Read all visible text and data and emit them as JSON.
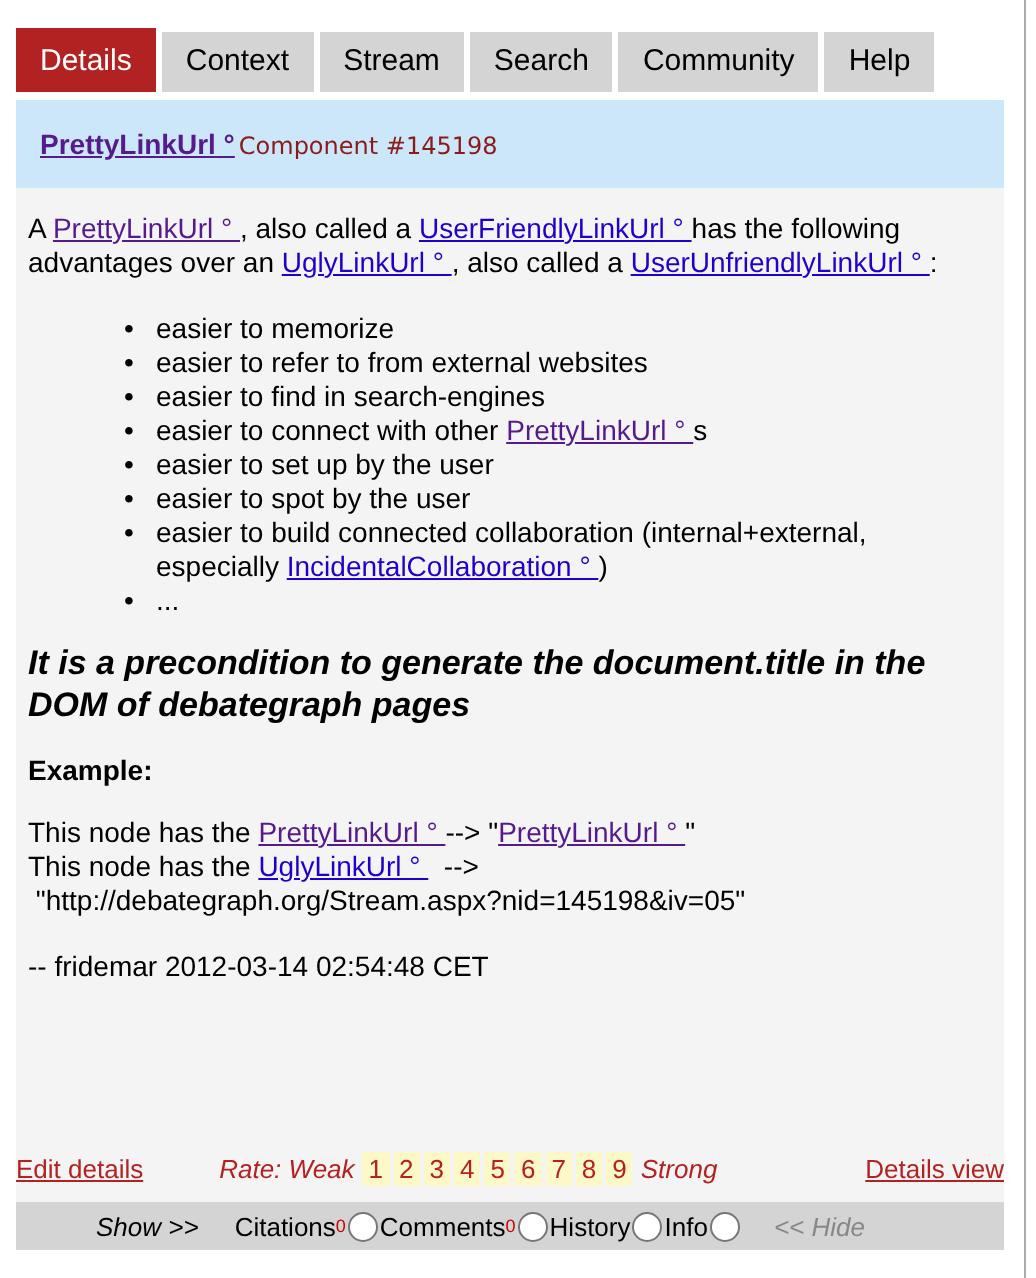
{
  "tabs": [
    {
      "label": "Details",
      "selected": true
    },
    {
      "label": "Context",
      "selected": false
    },
    {
      "label": "Stream",
      "selected": false
    },
    {
      "label": "Search",
      "selected": false
    },
    {
      "label": "Community",
      "selected": false
    },
    {
      "label": "Help",
      "selected": false
    }
  ],
  "header": {
    "title": "PrettyLinkUrl °",
    "subtitle": "Component #145198"
  },
  "intro": [
    {
      "text": "A "
    },
    {
      "text": "PrettyLinkUrl ° ",
      "link": true,
      "visited": true
    },
    {
      "text": ", also called a "
    },
    {
      "text": "UserFriendlyLinkUrl ° ",
      "link": true,
      "visited": false
    },
    {
      "text": "has the following advantages over  an "
    },
    {
      "text": "UglyLinkUrl ° ",
      "link": true,
      "visited": false
    },
    {
      "text": ", also called a "
    },
    {
      "text": "UserUnfriendlyLinkUrl ° ",
      "link": true,
      "visited": false
    },
    {
      "text": ":"
    }
  ],
  "bullets": [
    {
      "marker": "•",
      "segs": [
        {
          "text": "easier to memorize"
        }
      ]
    },
    {
      "marker": "•",
      "segs": [
        {
          "text": "easier to refer to from external websites"
        }
      ]
    },
    {
      "marker": "•",
      "segs": [
        {
          "text": "easier to find in search-engines"
        }
      ]
    },
    {
      "marker": "•",
      "segs": [
        {
          "text": "easier to connect with other "
        },
        {
          "text": "PrettyLinkUrl ° ",
          "link": true,
          "visited": true
        },
        {
          "text": "s"
        }
      ]
    },
    {
      "marker": "•",
      "segs": [
        {
          "text": "easier to set up by the user"
        }
      ]
    },
    {
      "marker": "•",
      "segs": [
        {
          "text": "easier to spot by the user"
        }
      ]
    },
    {
      "marker": "•",
      "segs": [
        {
          "text": "easier to build connected collaboration (internal+external, especially "
        },
        {
          "text": "IncidentalCollaboration ° ",
          "link": true,
          "visited": false
        },
        {
          "text": ")"
        }
      ]
    },
    {
      "marker": "•",
      "segs": [
        {
          "text": "..."
        }
      ]
    }
  ],
  "heading": "It is a precondition to generate the document.title in the DOM of debategraph pages",
  "example_label": "Example:",
  "example_lines": [
    [
      {
        "text": "This node has the "
      },
      {
        "text": "PrettyLinkUrl ° ",
        "link": true,
        "visited": true
      },
      {
        "text": "--> \""
      },
      {
        "text": "PrettyLinkUrl ° ",
        "link": true,
        "visited": true
      },
      {
        "text": "\""
      }
    ],
    [
      {
        "text": "This node has the "
      },
      {
        "text": "UglyLinkUrl ° ",
        "link": true,
        "visited": false
      },
      {
        "text": "  -->"
      },
      {
        "text": " \"http://debategraph.org/Stream.aspx?nid=145198&iv=05\""
      }
    ]
  ],
  "signature": "-- fridemar 2012-03-14 02:54:48 CET",
  "footer": {
    "edit": "Edit details",
    "rate_label": "Rate: Weak",
    "rates": [
      "1",
      "2",
      "3",
      "4",
      "5",
      "6",
      "7",
      "8",
      "9"
    ],
    "rate_end": "Strong",
    "view": "Details view"
  },
  "showbar": {
    "show": "Show >>",
    "items": [
      {
        "label": "Citations",
        "count": "0",
        "checked": false
      },
      {
        "label": "Comments",
        "count": "0",
        "checked": false
      },
      {
        "label": "History",
        "checked": false
      },
      {
        "label": "Info",
        "checked": false
      }
    ],
    "hide": "<< Hide"
  }
}
